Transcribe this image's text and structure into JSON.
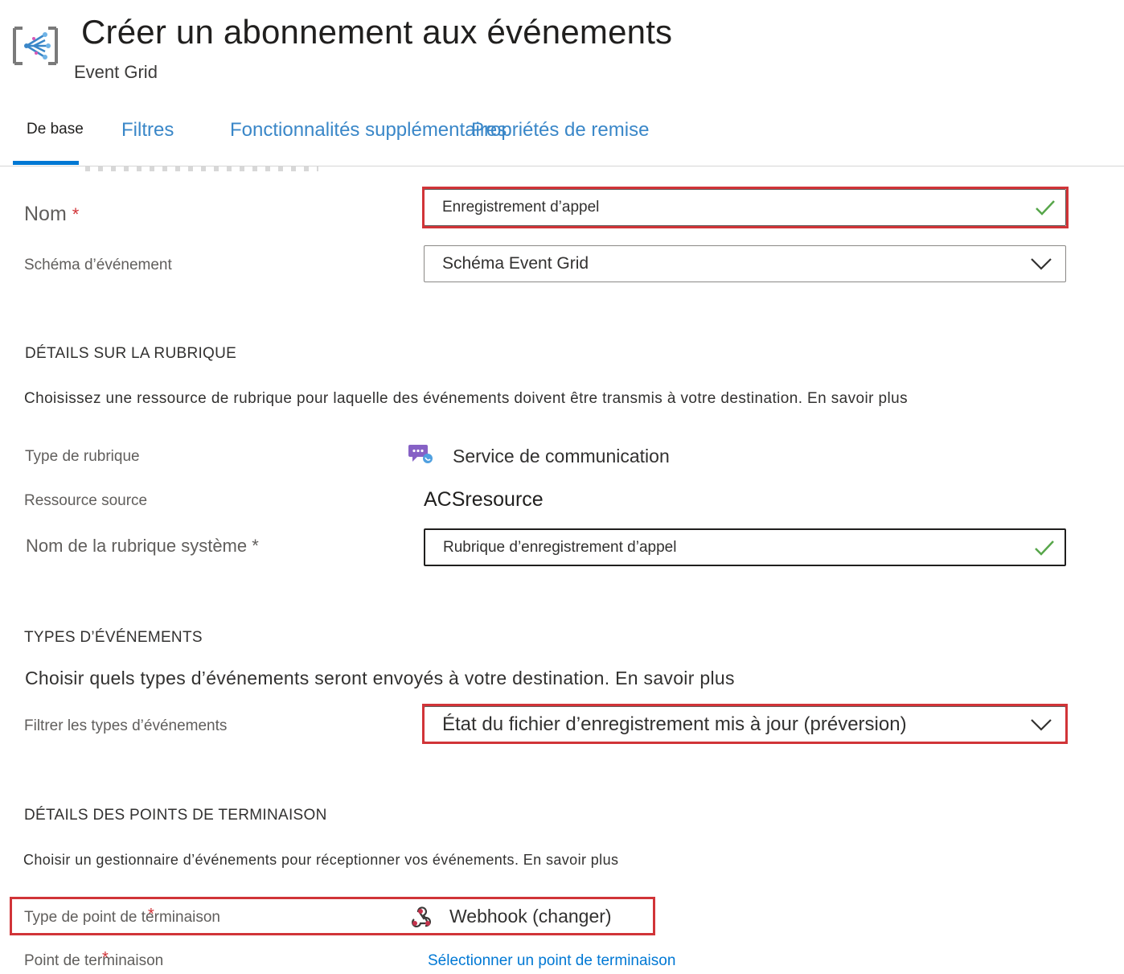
{
  "header": {
    "title": "Créer un abonnement aux événements",
    "subtitle": "Event Grid",
    "icon": "event-grid-icon"
  },
  "tabs": [
    {
      "label": "De base",
      "active": true
    },
    {
      "label": "Filtres",
      "active": false
    },
    {
      "label": "Fonctionnalités supplémentaires",
      "active": false
    },
    {
      "label": "Propriétés de remise",
      "active": false
    }
  ],
  "form": {
    "name": {
      "label": "Nom",
      "required_mark": "*",
      "value": "Enregistrement d’appel"
    },
    "event_schema": {
      "label": "Schéma d’événement",
      "value": "Schéma Event Grid"
    }
  },
  "topic_details": {
    "title": "DÉTAILS SUR LA RUBRIQUE",
    "description": "Choisissez une ressource de rubrique pour laquelle des événements doivent être transmis à votre destination. En savoir plus",
    "topic_type": {
      "label": "Type de rubrique",
      "value": "Service de communication",
      "icon": "communication-service-icon"
    },
    "source_resource": {
      "label": "Ressource source",
      "value": "ACSresource"
    },
    "system_topic_name": {
      "label": "Nom de la rubrique système",
      "required_mark": "*",
      "value": "Rubrique d’enregistrement d’appel"
    }
  },
  "event_types": {
    "title": "TYPES D’ÉVÉNEMENTS",
    "description": "Choisir quels types d’événements seront envoyés à votre destination. En savoir plus",
    "filter": {
      "label": "Filtrer les types d’événements",
      "value": "État du fichier d’enregistrement mis à jour (préversion)"
    }
  },
  "endpoint_details": {
    "title": "DÉTAILS DES POINTS DE TERMINAISON",
    "description": "Choisir un gestionnaire d’événements pour réceptionner vos événements. En savoir plus",
    "endpoint_type": {
      "label": "Type de point de terminaison",
      "required_mark": "*",
      "value": "Webhook (changer)",
      "icon": "webhook-icon"
    },
    "endpoint": {
      "label": "Point de terminaison",
      "required_mark": "*",
      "link": "Sélectionner un point de terminaison"
    }
  },
  "colors": {
    "accent": "#0078d4",
    "highlight": "#d13438",
    "valid": "#57a64a"
  }
}
